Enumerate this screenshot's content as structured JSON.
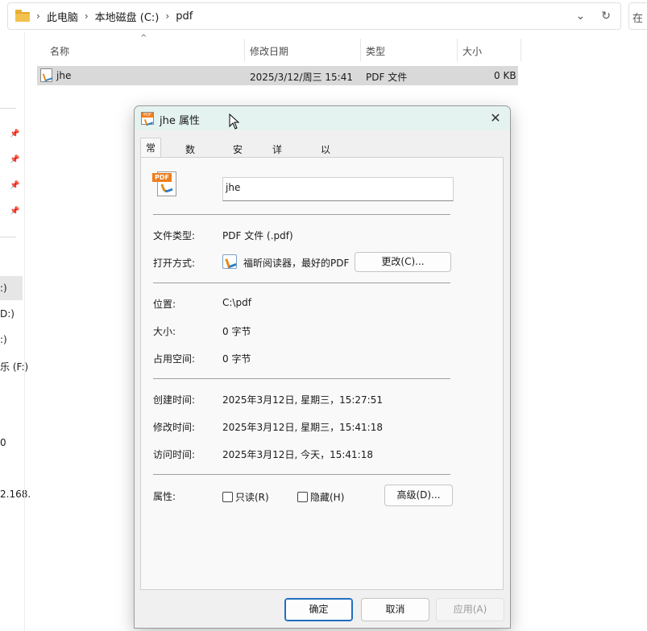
{
  "address": {
    "crumbs": [
      "此电脑",
      "本地磁盘 (C:)",
      "pdf"
    ],
    "search_fragment": "在"
  },
  "nav": {
    "drive_fragments": [
      ":)",
      "D:)",
      ":)",
      "乐 (F:)",
      "0",
      "2.168."
    ]
  },
  "file_list": {
    "headers": [
      "名称",
      "修改日期",
      "类型",
      "大小"
    ],
    "rows": [
      {
        "name": "jhe",
        "modified": "2025/3/12/周三 15:41",
        "type": "PDF 文件",
        "size": "0 KB"
      }
    ]
  },
  "dialog": {
    "title": "jhe 属性",
    "tabs": [
      "常规",
      "数字签名",
      "安全",
      "详细信息",
      "以前的版本"
    ],
    "active_tab": "常规",
    "file_name": "jhe",
    "icon_label": "PDF",
    "props": {
      "file_type_label": "文件类型:",
      "file_type_value": "PDF 文件 (.pdf)",
      "open_with_label": "打开方式:",
      "open_with_value": "福昕阅读器，最好的PDF",
      "change_button": "更改(C)...",
      "location_label": "位置:",
      "location_value": "C:\\pdf",
      "size_label": "大小:",
      "size_value": "0 字节",
      "disk_size_label": "占用空间:",
      "disk_size_value": "0 字节",
      "created_label": "创建时间:",
      "created_value": "2025年3月12日, 星期三，15:27:51",
      "modified_label": "修改时间:",
      "modified_value": "2025年3月12日, 星期三，15:41:18",
      "accessed_label": "访问时间:",
      "accessed_value": "2025年3月12日, 今天，15:41:18",
      "attributes_label": "属性:",
      "readonly_label": "只读(R)",
      "hidden_label": "隐藏(H)",
      "advanced_button": "高级(D)..."
    },
    "footer": {
      "ok": "确定",
      "cancel": "取消",
      "apply": "应用(A)"
    }
  }
}
